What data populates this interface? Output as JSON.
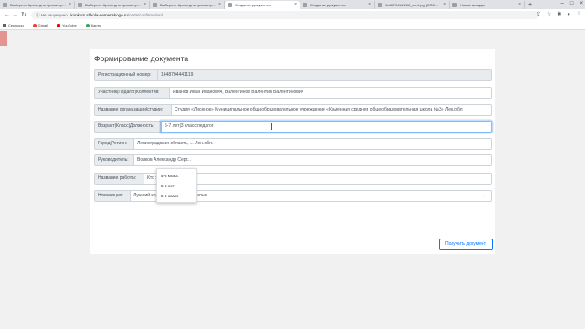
{
  "browser": {
    "tabs": [
      {
        "title": "Выберите Архив для просмотр...",
        "active": false
      },
      {
        "title": "Выберите Архив для просмотр...",
        "active": false
      },
      {
        "title": "Выберите Архив для просмотр...",
        "active": false
      },
      {
        "title": "Создание документа",
        "active": true
      },
      {
        "title": "Создание документа",
        "active": false
      },
      {
        "title": "1648704441119_cert.jpg (2000...",
        "active": false
      },
      {
        "title": "Новая вкладка",
        "active": false
      }
    ],
    "address_warning": "Не защищено",
    "address_domain": "konkurs.shkola-nemenskogo.ru",
    "address_path": "/certs/confirmation/",
    "bookmarks": [
      {
        "label": "Сервисы",
        "icon": "grid-icon"
      },
      {
        "label": "Gmail",
        "icon": "gmail-icon"
      },
      {
        "label": "YouTube",
        "icon": "youtube-icon"
      },
      {
        "label": "Карты",
        "icon": "maps-icon"
      }
    ]
  },
  "form": {
    "title": "Формирование документа",
    "fields": [
      {
        "label": "Регистрационный номер:",
        "value": "1648704441119"
      },
      {
        "label": "Участник|Педагог|Коллектив:",
        "value": "Иванов Иван Иванович, Валентинов Валентин Валентинович"
      },
      {
        "label": "Название организации|студии:",
        "value": "Студия «Лисенок»      Муниципальное общеобразовательное учреждение «Каменная средняя общеобразовательная школа №3» Лен.обл."
      },
      {
        "label": "Возраст|Класс|Должность:",
        "value": "5-7 лет|3 класс|педагог"
      },
      {
        "label": "Город|Регион:",
        "value": "Ленинградская область, ...                       Лен.обл."
      },
      {
        "label": "Руководитель:",
        "value": "Волков Александр Серг..."
      },
      {
        "label": "Название работы:",
        "value": "Кто живёт в моём доме"
      },
      {
        "label": "Номинация:",
        "value": "Лучший короткометражный фильм"
      }
    ],
    "suggestions": [
      "5-8 класс",
      "5-8 лет",
      "5-6 класс"
    ],
    "submit_label": "Получить документ"
  },
  "colors": {
    "accent": "#007bff",
    "label_bg": "#e9ecef",
    "side_patch": "#e5958f"
  }
}
